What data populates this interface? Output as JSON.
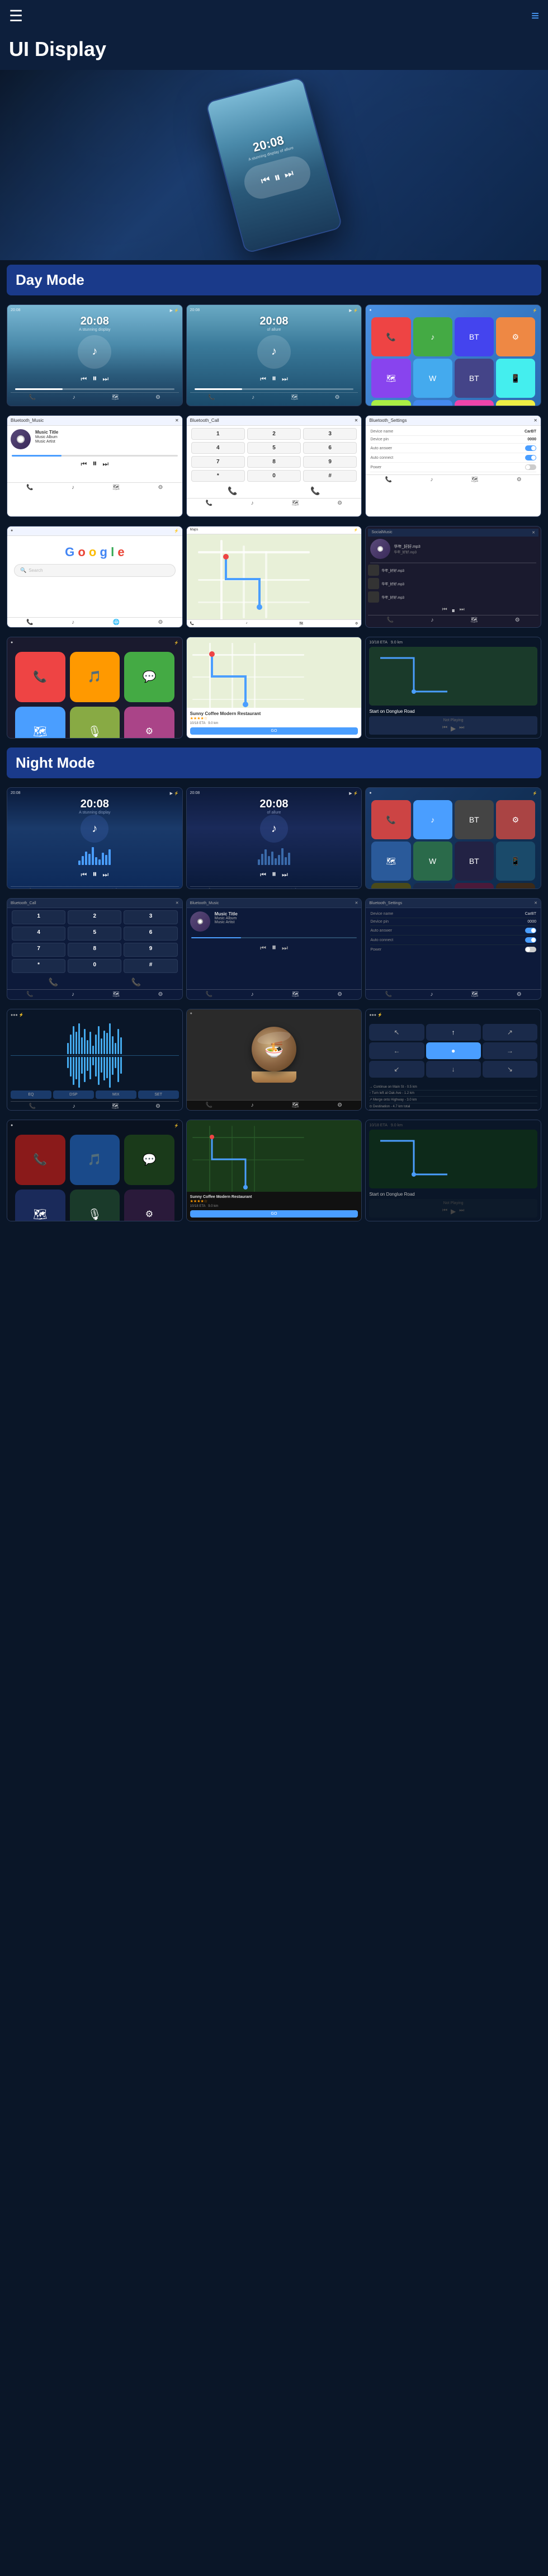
{
  "header": {
    "title": "UI Display",
    "menu_icon": "☰",
    "nav_icon": "≡"
  },
  "sections": {
    "day_mode": {
      "label": "Day Mode"
    },
    "night_mode": {
      "label": "Night Mode"
    }
  },
  "hero": {
    "time": "20:08",
    "subtitle": "A stunning display of allure"
  },
  "day_screens": [
    {
      "id": "day-music-1",
      "type": "music",
      "time": "20:08",
      "subtitle": "A stunning display",
      "mode": "day"
    },
    {
      "id": "day-music-2",
      "type": "music",
      "time": "20:08",
      "subtitle": "of allure",
      "mode": "day"
    },
    {
      "id": "day-app-grid",
      "type": "appgrid",
      "mode": "day"
    },
    {
      "id": "bluetooth-music",
      "type": "bluetooth_music",
      "title": "Bluetooth_Music",
      "track": "Music Title",
      "album": "Music Album",
      "artist": "Music Artist"
    },
    {
      "id": "bluetooth-call",
      "type": "bluetooth_call",
      "title": "Bluetooth_Call",
      "digits": [
        "1",
        "2",
        "3",
        "4",
        "5",
        "6",
        "7",
        "8",
        "9",
        "*",
        "0",
        "#"
      ]
    },
    {
      "id": "bluetooth-settings",
      "type": "bluetooth_settings",
      "title": "Bluetooth_Settings",
      "settings": [
        {
          "label": "Device name",
          "value": "CarBT"
        },
        {
          "label": "Device pin",
          "value": "0000"
        },
        {
          "label": "Auto answer",
          "value": "toggle_on"
        },
        {
          "label": "Auto connect",
          "value": "toggle_on"
        },
        {
          "label": "Power",
          "value": "toggle_off"
        }
      ]
    },
    {
      "id": "google",
      "type": "google",
      "search_placeholder": "Search"
    },
    {
      "id": "maps",
      "type": "maps"
    },
    {
      "id": "social-music",
      "type": "social_music",
      "title": "SocialMusic",
      "songs": [
        "华年_好好.mp3",
        "华年_好好.mp3",
        "华年_好好.mp3"
      ]
    },
    {
      "id": "carplay-apps",
      "type": "carplay_apps"
    },
    {
      "id": "carplay-restaurant",
      "type": "carplay_restaurant",
      "name": "Sunny Coffee Modern Restaurant",
      "rating": "★★★★☆",
      "distance": "10/18 ETA",
      "duration": "9.0 km",
      "button": "GO"
    },
    {
      "id": "carplay-nav",
      "type": "carplay_nav",
      "eta": "10/18 ETA  9.0 km",
      "direction": "Start on Donglue Road",
      "status": "Not Playing"
    }
  ],
  "night_screens": [
    {
      "id": "night-music-1",
      "type": "music_night",
      "time": "20:08",
      "mode": "night"
    },
    {
      "id": "night-music-2",
      "type": "music_night",
      "time": "20:08",
      "mode": "night"
    },
    {
      "id": "night-app-grid",
      "type": "appgrid_night",
      "mode": "night"
    },
    {
      "id": "night-bt-call",
      "type": "bluetooth_call_night",
      "title": "Bluetooth_Call"
    },
    {
      "id": "night-bt-music",
      "type": "bluetooth_music_night",
      "title": "Bluetooth_Music",
      "track": "Music Title",
      "album": "Music Album",
      "artist": "Music Artist"
    },
    {
      "id": "night-bt-settings",
      "type": "bluetooth_settings_night",
      "title": "Bluetooth_Settings"
    },
    {
      "id": "night-wave",
      "type": "waveform_night"
    },
    {
      "id": "night-food",
      "type": "food_video"
    },
    {
      "id": "night-nav",
      "type": "navigation_night"
    },
    {
      "id": "night-carplay-apps",
      "type": "carplay_apps_night"
    },
    {
      "id": "night-carplay-restaurant",
      "type": "carplay_restaurant_night",
      "name": "Sunny Coffee Modern Restaurant",
      "button": "GO"
    },
    {
      "id": "night-carplay-nav",
      "type": "carplay_nav_night",
      "direction": "Start on Donglue Road",
      "status": "Not Playing"
    }
  ],
  "icons": {
    "menu": "☰",
    "nav": "≡",
    "music_note": "♪",
    "play": "▶",
    "pause": "⏸",
    "prev": "⏮",
    "next": "⏭",
    "phone": "📞",
    "search": "🔍",
    "location": "📍",
    "arrow_up": "↑",
    "arrow_down": "↓",
    "arrow_left": "←",
    "arrow_right": "→"
  },
  "colors": {
    "day_blue": "#4a9eff",
    "night_dark": "#0a1628",
    "accent": "#1a3a8a",
    "green": "#34a853"
  }
}
